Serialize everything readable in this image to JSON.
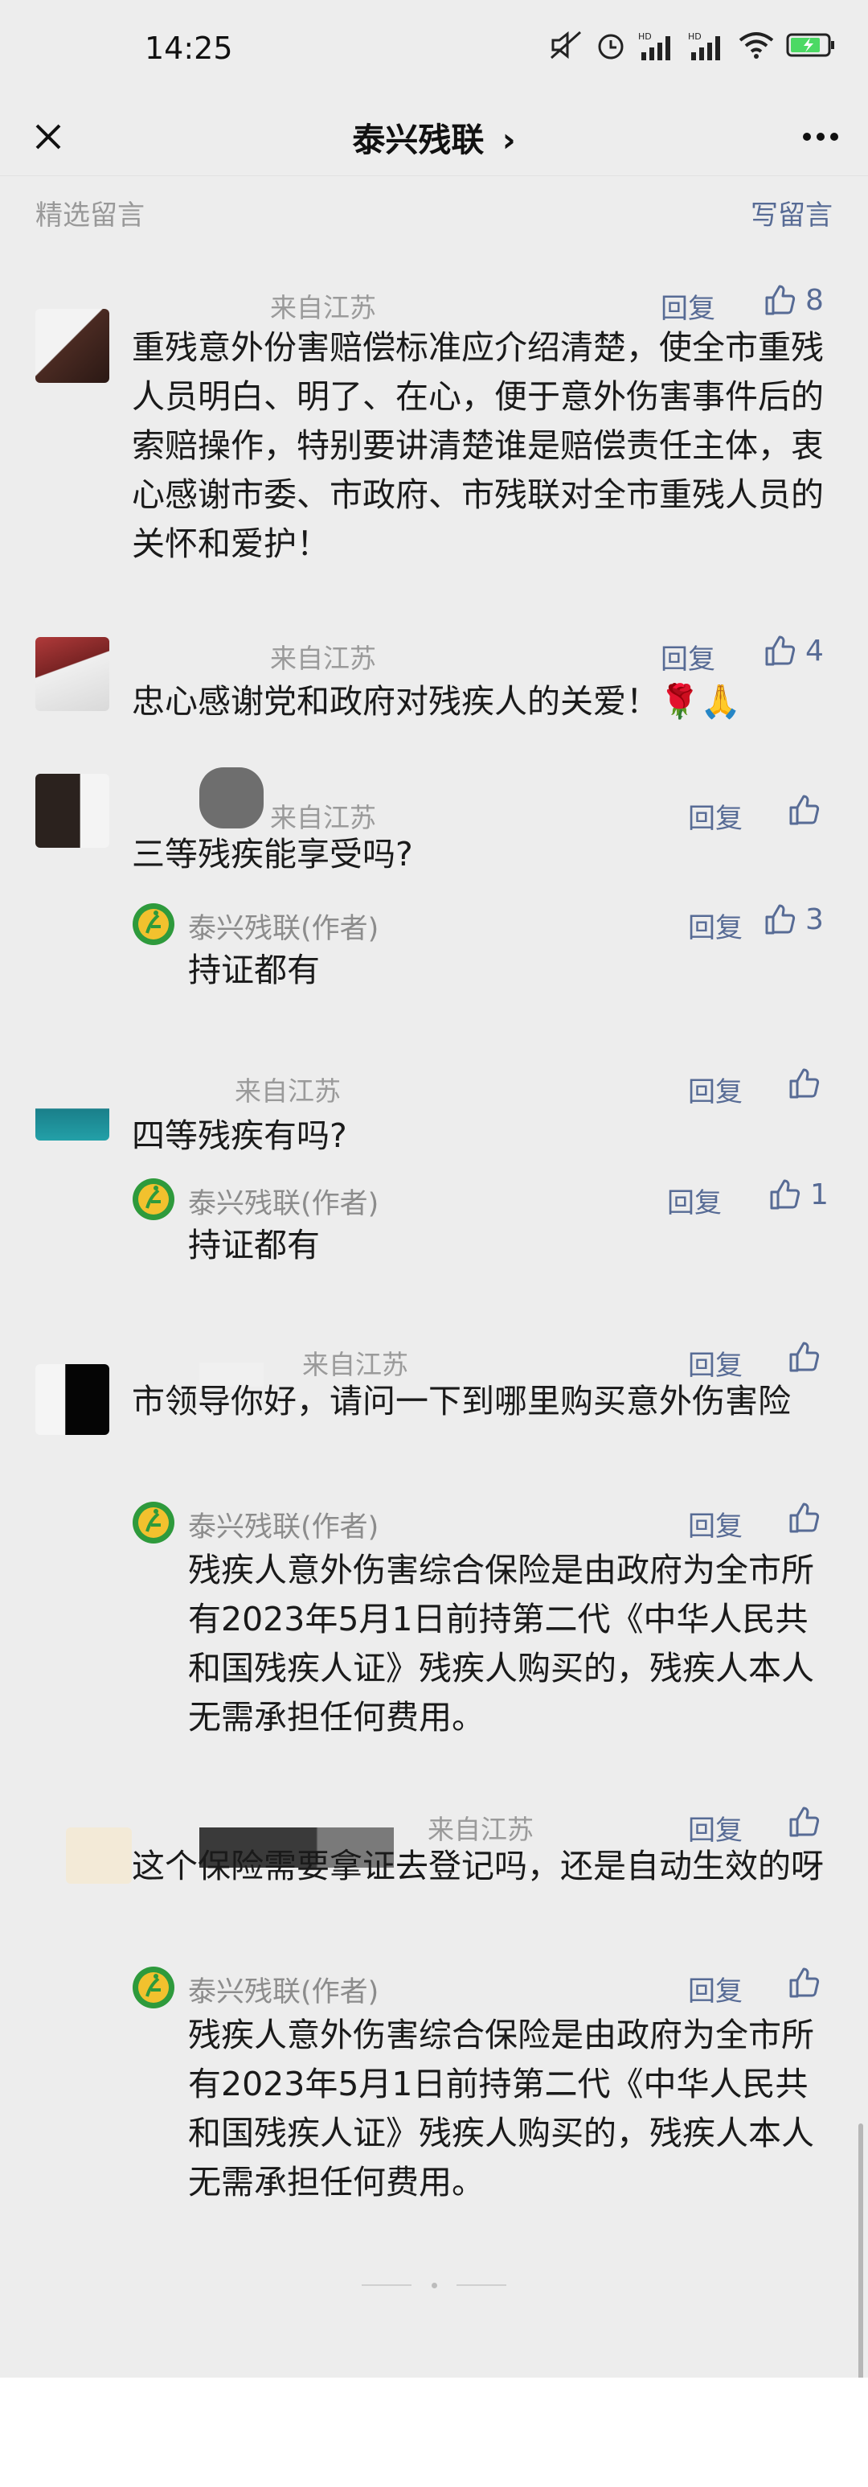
{
  "status_bar": {
    "time": "14:25"
  },
  "nav": {
    "title": "泰兴残联",
    "chevron": "›"
  },
  "section": {
    "title": "精选留言",
    "write_label": "写留言"
  },
  "reply_label": "回复",
  "author_name": "泰兴残联(作者)",
  "colors": {
    "link": "#576b95",
    "background": "#ededed"
  },
  "comments": [
    {
      "location": "来自江苏",
      "likes": "8",
      "text": "重残意外份害赔偿标准应介绍清楚，使全市重残人员明白、明了、在心，便于意外伤害事件后的索赔操作，特别要讲清楚谁是赔偿责任主体，衷心感谢市委、市政府、市残联对全市重残人员的关怀和爱护！"
    },
    {
      "location": "来自江苏",
      "likes": "4",
      "text": "忠心感谢党和政府对残疾人的关爱！🌹🙏"
    },
    {
      "location": "来自江苏",
      "likes": "",
      "text": "三等残疾能享受吗?",
      "author_reply": {
        "likes": "3",
        "text": "持证都有"
      }
    },
    {
      "location": "来自江苏",
      "likes": "",
      "text": "四等残疾有吗?",
      "author_reply": {
        "likes": "1",
        "text": "持证都有"
      }
    },
    {
      "location": "来自江苏",
      "likes": "",
      "text": "市领导你好，请问一下到哪里购买意外伤害险",
      "author_reply": {
        "likes": "",
        "text": "残疾人意外伤害综合保险是由政府为全市所有2023年5月1日前持第二代《中华人民共和国残疾人证》残疾人购买的，残疾人本人无需承担任何费用。"
      }
    },
    {
      "location": "来自江苏",
      "likes": "",
      "text": "这个保险需要拿证去登记吗，还是自动生效的呀",
      "author_reply": {
        "likes": "",
        "text": "残疾人意外伤害综合保险是由政府为全市所有2023年5月1日前持第二代《中华人民共和国残疾人证》残疾人购买的，残疾人本人无需承担任何费用。"
      }
    }
  ]
}
